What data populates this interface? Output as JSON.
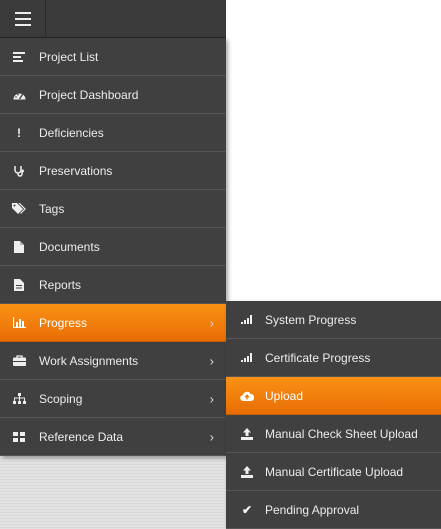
{
  "topbar": {
    "menu_icon": "hamburger-icon"
  },
  "menu": {
    "items": [
      {
        "label": "Project List",
        "icon": "list-icon"
      },
      {
        "label": "Project Dashboard",
        "icon": "dashboard-icon"
      },
      {
        "label": "Deficiencies",
        "icon": "exclamation-icon"
      },
      {
        "label": "Preservations",
        "icon": "stethoscope-icon"
      },
      {
        "label": "Tags",
        "icon": "tags-icon"
      },
      {
        "label": "Documents",
        "icon": "document-icon"
      },
      {
        "label": "Reports",
        "icon": "report-icon"
      },
      {
        "label": "Progress",
        "icon": "bar-chart-icon",
        "active": true,
        "has_submenu": true
      },
      {
        "label": "Work Assignments",
        "icon": "briefcase-icon",
        "has_submenu": true
      },
      {
        "label": "Scoping",
        "icon": "sitemap-icon",
        "has_submenu": true
      },
      {
        "label": "Reference Data",
        "icon": "grid-icon",
        "has_submenu": true
      }
    ],
    "chevron": "›"
  },
  "submenu": {
    "items": [
      {
        "label": "System Progress",
        "icon": "signal-icon"
      },
      {
        "label": "Certificate Progress",
        "icon": "signal-icon"
      },
      {
        "label": "Upload",
        "icon": "cloud-upload-icon",
        "active": true
      },
      {
        "label": "Manual Check Sheet Upload",
        "icon": "upload-icon"
      },
      {
        "label": "Manual Certificate Upload",
        "icon": "upload-icon"
      },
      {
        "label": "Pending Approval",
        "icon": "check-icon"
      }
    ]
  },
  "colors": {
    "accent": "#f7870c",
    "menu_bg": "#404040",
    "divider": "#555555"
  }
}
